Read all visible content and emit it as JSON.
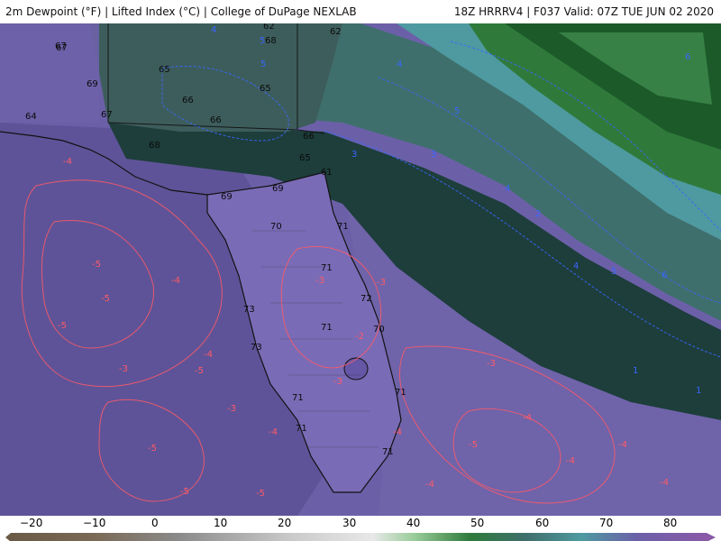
{
  "header": {
    "left": "2m Dewpoint (°F) | Lifted Index (°C) | College of DuPage NEXLAB",
    "right": "18Z HRRRV4 | F037 Valid: 07Z TUE JUN 02 2020"
  },
  "legend": {
    "ticks": [
      "−20",
      "−10",
      "0",
      "10",
      "20",
      "30",
      "40",
      "50",
      "60",
      "70",
      "80"
    ]
  },
  "map": {
    "dewpoint_labels": [
      "62",
      "62",
      "65",
      "66",
      "66",
      "65",
      "67",
      "69",
      "67",
      "68",
      "69",
      "66",
      "65",
      "64",
      "61",
      "70",
      "71",
      "71",
      "72",
      "73",
      "70",
      "73",
      "71",
      "71",
      "71",
      "71",
      "71",
      "68",
      "69",
      "67"
    ],
    "lifted_index_labels_red": [
      "-4",
      "-5",
      "-5",
      "-5",
      "-4",
      "-4",
      "-3",
      "-5",
      "-3",
      "-3",
      "-5",
      "-4",
      "-3",
      "-3",
      "-2",
      "-3",
      "-4",
      "-4",
      "-5",
      "-5",
      "-4",
      "-4",
      "-5",
      "-4",
      "-4"
    ],
    "lifted_index_labels_blue": [
      "4",
      "5",
      "5",
      "3",
      "5",
      "4",
      "6",
      "4",
      "5",
      "6",
      "4",
      "3",
      "2",
      "1",
      "1"
    ]
  },
  "colors": {
    "water_dry": "#5b4f8f",
    "water_moist": "#6e62a6",
    "land_moist": "#7566b0",
    "dark_band": "#1d3e3b",
    "teal_band": "#3f6f6c",
    "teal_light": "#4e9aa0",
    "green_deep": "#1c5a2a",
    "green_mid": "#2f7a3b",
    "green_light": "#4fa35c",
    "li_red": "#ff5a66",
    "li_blue": "#3a66ff"
  }
}
